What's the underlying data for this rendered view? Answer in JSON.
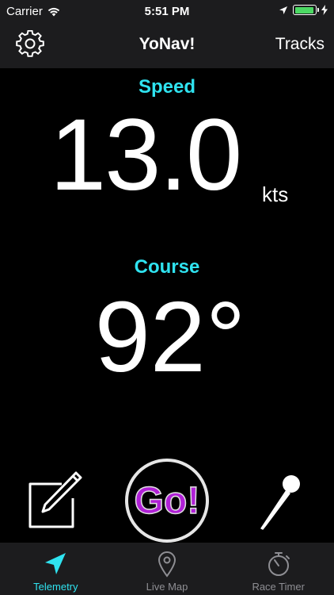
{
  "status_bar": {
    "carrier": "Carrier",
    "time": "5:51 PM"
  },
  "nav": {
    "title": "YoNav!",
    "right_button": "Tracks",
    "left_icon": "gear-icon"
  },
  "telemetry": {
    "speed_label": "Speed",
    "speed_value": "13.0",
    "speed_unit": "kts",
    "course_label": "Course",
    "course_value": "92°"
  },
  "actions": {
    "edit_icon": "edit-note-icon",
    "go_label": "Go!",
    "pin_icon": "pin-icon"
  },
  "tabs": [
    {
      "label": "Telemetry",
      "icon": "navigation-arrow-icon",
      "active": true
    },
    {
      "label": "Live Map",
      "icon": "map-pin-icon",
      "active": false
    },
    {
      "label": "Race Timer",
      "icon": "stopwatch-icon",
      "active": false
    }
  ],
  "colors": {
    "accent": "#2fe3f0",
    "go_text": "#b020d6",
    "battery": "#4cd964",
    "background": "#000000",
    "chrome": "#1c1c1e",
    "tab_inactive": "#8e8e93"
  }
}
